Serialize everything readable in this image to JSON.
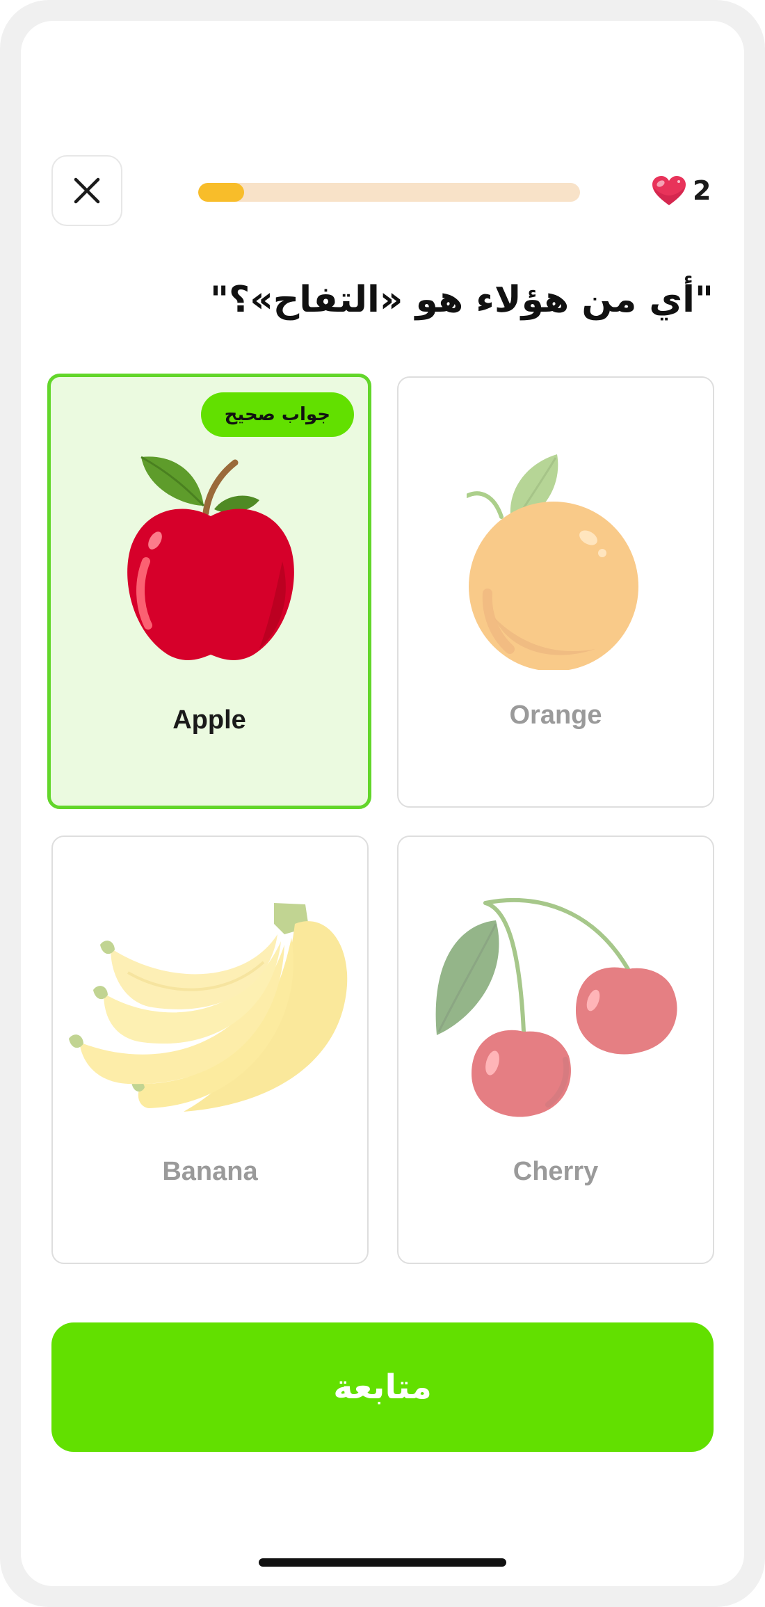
{
  "header": {
    "close_icon": "close-icon",
    "progress_fraction": 0.12,
    "hearts_icon": "heart-icon",
    "hearts_count": "2",
    "colors": {
      "progress_track": "#f8e2c8",
      "progress_fill": "#f8bd2a",
      "heart": "#e8335a"
    }
  },
  "question": {
    "text": "\"أي من هؤلاء هو «التفاح»؟\""
  },
  "options": [
    {
      "label": "Apple",
      "icon": "apple-icon",
      "state": "correct",
      "badge": "جواب صحيح"
    },
    {
      "label": "Orange",
      "icon": "orange-icon",
      "state": "dimmed"
    },
    {
      "label": "Banana",
      "icon": "banana-icon",
      "state": "dimmed"
    },
    {
      "label": "Cherry",
      "icon": "cherry-icon",
      "state": "dimmed"
    }
  ],
  "continue_button": {
    "label": "متابعة",
    "color": "#62e000"
  },
  "colors": {
    "correct_border": "#62d62a",
    "correct_background": "#ebfae0",
    "badge": "#62e000"
  }
}
